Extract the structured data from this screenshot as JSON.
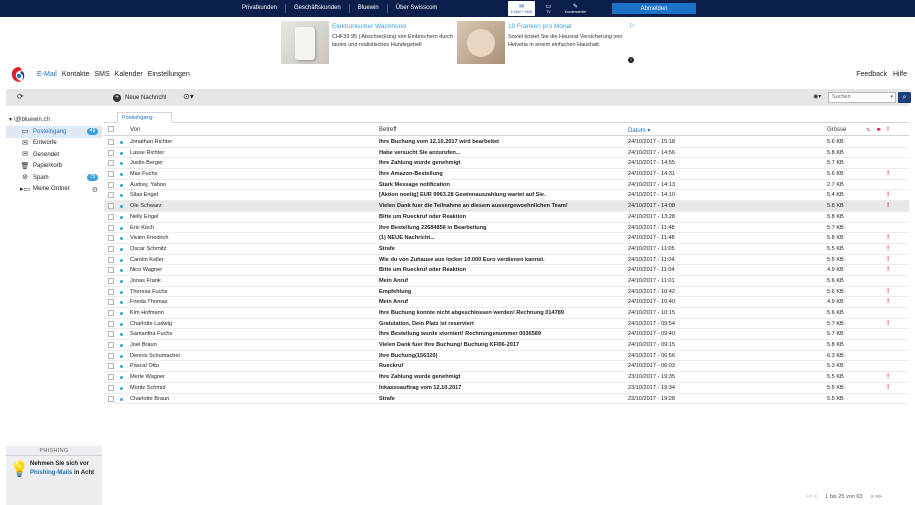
{
  "topnav": {
    "items": [
      "Privatkunden",
      "Geschäftskunden",
      "Bluewin",
      "Über Swisscom"
    ],
    "icons": [
      {
        "label": "E-Mail + SMS",
        "glyph": "✉",
        "name": "mail-sms-icon",
        "active": true
      },
      {
        "label": "TV",
        "glyph": "▭",
        "name": "tv-icon",
        "active": false
      },
      {
        "label": "Kundencenter",
        "glyph": "✎",
        "name": "kundencenter-icon",
        "active": false
      }
    ],
    "logout": "Abmelden"
  },
  "ads": [
    {
      "title": "Elektronischer Wachhund",
      "text": "CHF39.95 | Abschreckung von Einbrechern durch lautes und realistisches Hundegebell"
    },
    {
      "title": "10 Franken pro Monat",
      "text": "Soviel kostet Sie die Hausrat Versicherung von Helvetia in einem einfachen Haushalt."
    }
  ],
  "appnav": {
    "items": [
      "E-Mail",
      "Kontakte",
      "SMS",
      "Kalender",
      "Einstellungen"
    ],
    "active": "E-Mail",
    "right": [
      "Feedback",
      "Hilfe"
    ]
  },
  "toolbar": {
    "new_message": "Neue Nachricht",
    "search_placeholder": "Suchen"
  },
  "sidebar": {
    "account": "\\@bluewin.ch",
    "folders": [
      {
        "label": "Posteingang",
        "icon": "inbox-icon",
        "glyph": "▭",
        "badge": "49",
        "active": true
      },
      {
        "label": "Entwürfe",
        "icon": "drafts-icon",
        "glyph": "✉",
        "badge": "",
        "active": false
      },
      {
        "label": "Gesendet",
        "icon": "sent-icon",
        "glyph": "✉",
        "badge": "",
        "active": false
      },
      {
        "label": "Papierkorb",
        "icon": "trash-icon",
        "glyph": "🗑",
        "badge": "",
        "active": false
      },
      {
        "label": "Spam",
        "icon": "spam-icon",
        "glyph": "⊘",
        "badge": "75",
        "active": false
      },
      {
        "label": "Meine Ordner",
        "icon": "my-folders-icon",
        "glyph": "▸▭",
        "badge": "",
        "active": false,
        "gear": true
      }
    ],
    "phishing": {
      "heading": "PHISHING",
      "text_before": "Nehmen Sie sich vor ",
      "link": "Phishing-Mails",
      "text_after": " in Acht"
    }
  },
  "mail": {
    "tab": "Posteingang",
    "columns": {
      "from": "Von",
      "subject": "Betreff",
      "date": "Datum",
      "size": "Grösse"
    },
    "rows": [
      {
        "from": "Jonathan Richter",
        "subject": "Ihre Buchung vom 12.10.2017 wird bearbeitet",
        "date": "24/10/2017 - 15:18",
        "size": "5.6 KB",
        "flag": false
      },
      {
        "from": "Lasse Richter",
        "subject": "Habe versucht Sie anzurufen...",
        "date": "24/10/2017 - 14:56",
        "size": "5.8 KB",
        "flag": false
      },
      {
        "from": "Justin Berger",
        "subject": "Ihre Zahlung wurde genehmigt",
        "date": "24/10/2017 - 14:55",
        "size": "5.7 KB",
        "flag": false
      },
      {
        "from": "Max Fuchs",
        "subject": "Ihre Amazon-Bestellung",
        "date": "24/10/2017 - 14:31",
        "size": "5.6 KB",
        "flag": true
      },
      {
        "from": "Audrey, Yahoo",
        "subject": "Stark Message notification",
        "date": "24/10/2017 - 14:13",
        "size": "2.7 KB",
        "flag": false
      },
      {
        "from": "Silas Engel",
        "subject": "[Aktion noetig] EUR 9963.28 Gewinnauszahlung wartet auf Sie.",
        "date": "24/10/2017 - 14:10",
        "size": "5.4 KB",
        "flag": true
      },
      {
        "from": "Ole Schwarz",
        "subject": "Vielen Dank fuer die Teilnahme an diesem aussergewoehnlichen Team!",
        "date": "24/10/2017 - 14:08",
        "size": "5.8 KB",
        "flag": true,
        "selected": true
      },
      {
        "from": "Nelly Engel",
        "subject": "Bitte um Rueckruf oder Reaktion",
        "date": "24/10/2017 - 13:28",
        "size": "5.8 KB",
        "flag": false
      },
      {
        "from": "Eric Koch",
        "subject": "Ihre Bestellung 22684856 in Bearbeitung",
        "date": "24/10/2017 - 11:48",
        "size": "5.7 KB",
        "flag": false
      },
      {
        "from": "Vivien Friedrich",
        "subject": "(1) NEUE Nachricht...",
        "date": "24/10/2017 - 11:48",
        "size": "5.8 KB",
        "flag": true
      },
      {
        "from": "Oscar Schmitz",
        "subject": "Strafe",
        "date": "24/10/2017 - 11:05",
        "size": "5.5 KB",
        "flag": true
      },
      {
        "from": "Carolin Keller",
        "subject": "Wie du von Zuhause aus locker 10.000 Euro verdienen kannst.",
        "date": "24/10/2017 - 11:04",
        "size": "5.5 KB",
        "flag": true
      },
      {
        "from": "Nico Wagner",
        "subject": "Bitte um Rueckruf oder Reaktion",
        "date": "24/10/2017 - 11:04",
        "size": "4.9 KB",
        "flag": true
      },
      {
        "from": "Jonas Frank",
        "subject": "Mein Anruf",
        "date": "24/10/2017 - 11:01",
        "size": "5.6 KB",
        "flag": false
      },
      {
        "from": "Theresa Fuchs",
        "subject": "Empfehlung",
        "date": "24/10/2017 - 10:42",
        "size": "5.6 KB",
        "flag": true
      },
      {
        "from": "Frieda Thomas",
        "subject": "Mein Anruf",
        "date": "24/10/2017 - 10:40",
        "size": "4.9 KB",
        "flag": true
      },
      {
        "from": "Kim Hofmann",
        "subject": "Ihre Buchung konnte nicht abgeschlossen werden! Rechnung 014789",
        "date": "24/10/2017 - 10:15",
        "size": "5.6 KB",
        "flag": false
      },
      {
        "from": "Charlotte Ludwig",
        "subject": "Gratulation, Dein Platz ist reserviert",
        "date": "24/10/2017 - 09:54",
        "size": "5.7 KB",
        "flag": true
      },
      {
        "from": "Samantha Fuchs",
        "subject": "Ihre Bestellung wurde storniert! Rechnungsnummer 0036589",
        "date": "24/10/2017 - 09:40",
        "size": "5.7 KB",
        "flag": false
      },
      {
        "from": "Joel Braun",
        "subject": "Vielen Dank fuer Ihre Buchung! Buchung KFI06-2017",
        "date": "24/10/2017 - 09:15",
        "size": "5.8 KB",
        "flag": false
      },
      {
        "from": "Dennis Schumacher",
        "subject": "Ihre Buchung(156320)",
        "date": "24/10/2017 - 06:56",
        "size": "6.3 KB",
        "flag": false
      },
      {
        "from": "Pascal Otto",
        "subject": "Rueckruf",
        "date": "24/10/2017 - 06:03",
        "size": "5.3 KB",
        "flag": false
      },
      {
        "from": "Merle Wagner",
        "subject": "Ihre Zahlung wurde genehmigt",
        "date": "23/10/2017 - 19:35",
        "size": "5.5 KB",
        "flag": true
      },
      {
        "from": "Moritz Schmid",
        "subject": "Inkassoauftrag vom 12.10.2017",
        "date": "23/10/2017 - 19:34",
        "size": "5.5 KB",
        "flag": true
      },
      {
        "from": "Charlotte Braun",
        "subject": "Strafe",
        "date": "23/10/2017 - 19:28",
        "size": "5.5 KB",
        "flag": false
      }
    ],
    "pager": {
      "first_prev": "<< <",
      "status": "1 bis 25 von 63",
      "next_last": "> >>"
    }
  },
  "colors": {
    "accent": "#1a73c7",
    "topbar": "#0b1f4d",
    "flag": "#e21d2f",
    "unread_dot": "#3aa0e0"
  }
}
